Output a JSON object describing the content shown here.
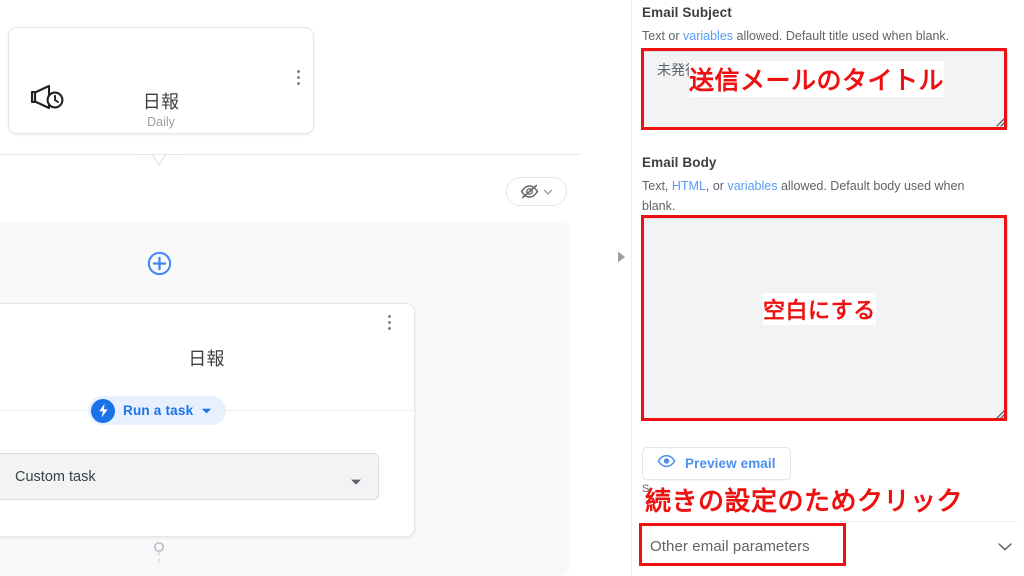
{
  "canvas": {
    "trigger_card": {
      "icon": "megaphone-clock-icon",
      "title": "日報",
      "subtitle": "Daily",
      "menu_icon": "kebab-menu-icon"
    },
    "visibility_pill": {
      "icon": "eye-slash-icon",
      "caret_icon": "chevron-down-icon"
    },
    "add_button": {
      "icon": "plus-circle-icon"
    },
    "action_card": {
      "title": "日報",
      "menu_icon": "kebab-menu-icon",
      "chip": {
        "icon": "bolt-icon",
        "label": "Run a task",
        "caret_icon": "caret-down-icon"
      },
      "select": {
        "value": "Custom task",
        "caret_icon": "caret-down-icon"
      }
    },
    "connector_icon": "node-output-connector-icon"
  },
  "splitter": {
    "expander_icon": "triangle-right-icon"
  },
  "properties": {
    "email_subject": {
      "label": "Email Subject",
      "help_prefix": "Text or ",
      "help_link": "variables",
      "help_suffix": " allowed. Default title used when blank.",
      "value": "未発行",
      "resize_icon": "resize-grip-icon"
    },
    "email_body": {
      "label": "Email Body",
      "help_prefix": "Text, ",
      "help_link1": "HTML",
      "help_mid": ", or ",
      "help_link2": "variables",
      "help_suffix": " allowed. Default body used when blank.",
      "value": "",
      "resize_icon": "resize-grip-icon"
    },
    "preview_button": {
      "icon": "eye-icon",
      "label": "Preview email"
    },
    "obscured_text": "S",
    "other_parameters": {
      "label": "Other email parameters",
      "caret_icon": "chevron-down-icon"
    }
  },
  "annotations": {
    "subject_note": "送信メールのタイトル",
    "body_note": "空白にする",
    "params_note": "続きの設定のためクリック"
  },
  "colors": {
    "accent_blue": "#1a73e8",
    "link_blue": "#5a9cf8",
    "annotation_red": "#ee1111",
    "panel_gray": "#f1f3f4",
    "canvas_group": "#f8f9fb"
  }
}
